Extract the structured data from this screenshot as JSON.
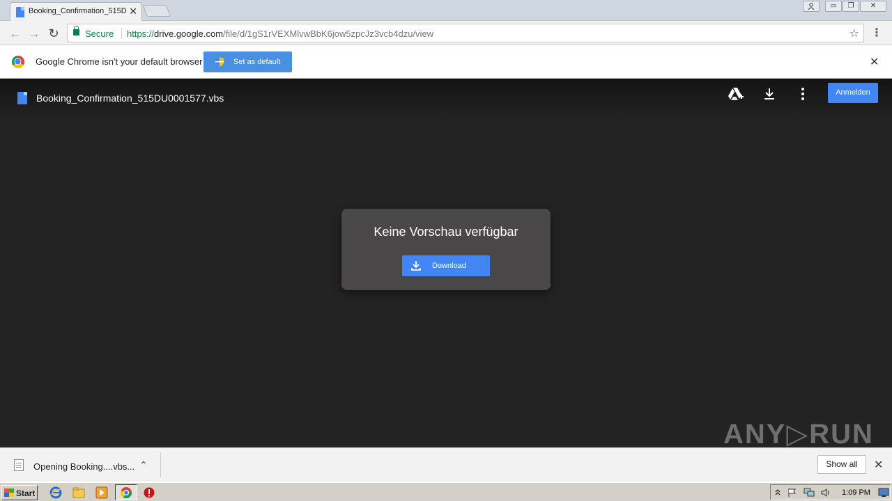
{
  "browser": {
    "tab": {
      "title": "Booking_Confirmation_515D",
      "close_glyph": "✕"
    },
    "window_controls": {
      "minimize": "▭",
      "restore": "❐",
      "close": "✕"
    },
    "nav": {
      "back_glyph": "←",
      "forward_glyph": "→",
      "reload_glyph": "↻"
    },
    "omnibox": {
      "security_label": "Secure",
      "url_scheme": "https://",
      "url_host": "drive.google.com",
      "url_path": "/file/d/1gS1rVEXMlvwBbK6jow5zpcJz3vcb4dzu/view",
      "star_glyph": "☆"
    },
    "menu_glyph": "⋮"
  },
  "infobar": {
    "message": "Google Chrome isn't your default browser",
    "button_label": "Set as default",
    "close_glyph": "✕"
  },
  "drive": {
    "file_name": "Booking_Confirmation_515DU0001577.vbs",
    "signin_label": "Anmelden",
    "preview": {
      "message": "Keine Vorschau verfügbar",
      "download_label": "Download"
    },
    "header_icons": [
      "add-to-drive-icon",
      "download-icon",
      "more-options-icon"
    ]
  },
  "watermark": "ANY▷RUN",
  "download_shelf": {
    "item_text": "Opening Booking....vbs...",
    "chevron_glyph": "⌃",
    "show_all_label": "Show all",
    "close_glyph": "✕"
  },
  "taskbar": {
    "start_label": "Start",
    "clock": "1:09 PM"
  },
  "colors": {
    "accent_blue": "#4285f4",
    "secure_green": "#0b8043",
    "viewer_bg": "#232323",
    "card_bg": "#4a4748"
  }
}
